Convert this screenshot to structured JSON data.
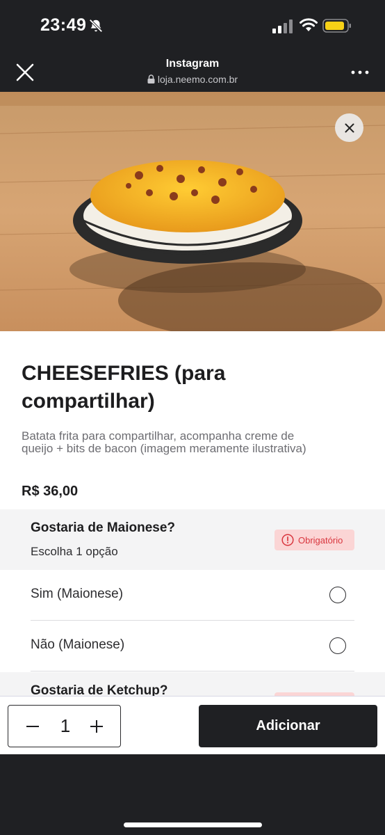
{
  "status": {
    "time": "23:49"
  },
  "browser": {
    "title": "Instagram",
    "url": "loja.neemo.com.br"
  },
  "product": {
    "title": "CHEESEFRIES (para compartilhar)",
    "description": "Batata frita para compartilhar, acompanha creme de queijo + bits de bacon (imagem meramente ilustrativa)",
    "price": "R$ 36,00"
  },
  "groups": [
    {
      "title": "Gostaria de Maionese?",
      "subtitle": "Escolha 1 opção",
      "badge": "Obrigatório",
      "options": [
        "Sim (Maionese)",
        "Não (Maionese)"
      ]
    },
    {
      "title": "Gostaria de Ketchup?"
    }
  ],
  "footer": {
    "quantity": "1",
    "add_label": "Adicionar"
  },
  "colors": {
    "accent": "#1f2023",
    "badge_bg": "#fbd5d5",
    "badge_text": "#d9363e"
  },
  "icons": [
    "bell-slash-icon",
    "signal-icon",
    "wifi-icon",
    "battery-icon",
    "close-icon",
    "lock-icon",
    "more-icon",
    "alert-circle-icon",
    "minus-icon",
    "plus-icon"
  ]
}
